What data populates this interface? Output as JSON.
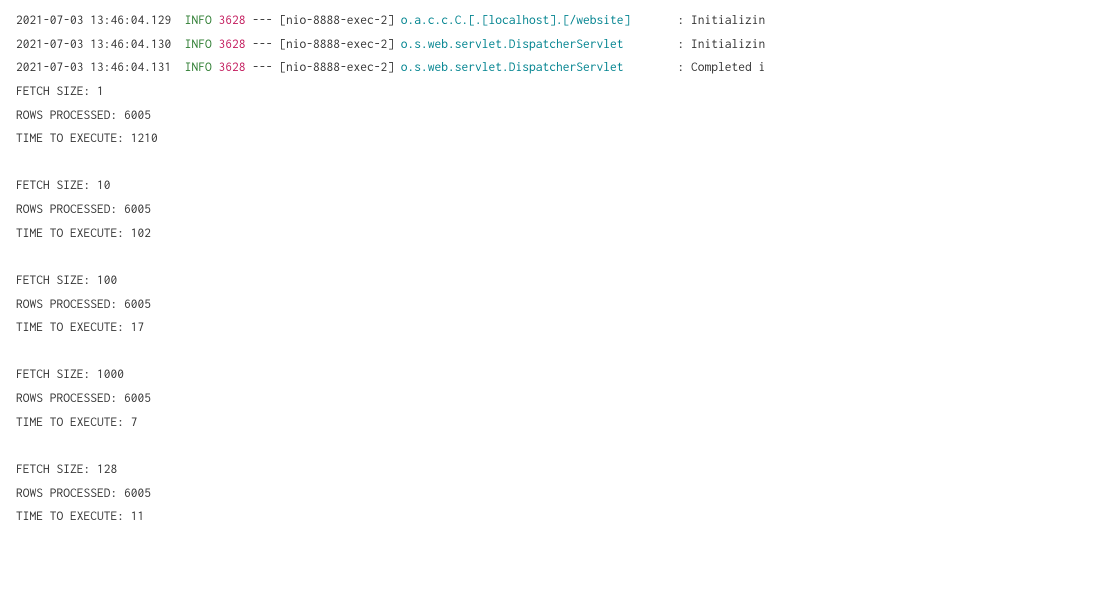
{
  "logLines": [
    {
      "timestamp": "2021-07-03 13:46:04.129",
      "level": "INFO",
      "pid": "3628",
      "separator": "---",
      "thread": "[nio-8888-exec-2]",
      "logger": "o.a.c.c.C.[.[localhost].[/website]      ",
      "colon": ":",
      "message": "Initializin"
    },
    {
      "timestamp": "2021-07-03 13:46:04.130",
      "level": "INFO",
      "pid": "3628",
      "separator": "---",
      "thread": "[nio-8888-exec-2]",
      "logger": "o.s.web.servlet.DispatcherServlet       ",
      "colon": ":",
      "message": "Initializin"
    },
    {
      "timestamp": "2021-07-03 13:46:04.131",
      "level": "INFO",
      "pid": "3628",
      "separator": "---",
      "thread": "[nio-8888-exec-2]",
      "logger": "o.s.web.servlet.DispatcherServlet       ",
      "colon": ":",
      "message": "Completed i"
    }
  ],
  "plainLines": [
    "FETCH SIZE: 1",
    "ROWS PROCESSED: 6005",
    "TIME TO EXECUTE: 1210",
    "",
    "FETCH SIZE: 10",
    "ROWS PROCESSED: 6005",
    "TIME TO EXECUTE: 102",
    "",
    "FETCH SIZE: 100",
    "ROWS PROCESSED: 6005",
    "TIME TO EXECUTE: 17",
    "",
    "FETCH SIZE: 1000",
    "ROWS PROCESSED: 6005",
    "TIME TO EXECUTE: 7",
    "",
    "FETCH SIZE: 128",
    "ROWS PROCESSED: 6005",
    "TIME TO EXECUTE: 11"
  ]
}
